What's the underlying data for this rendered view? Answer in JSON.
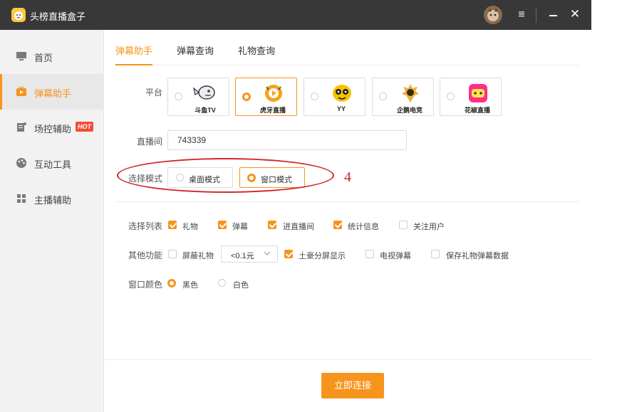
{
  "window": {
    "title": "头榜直播盒子"
  },
  "sidebar": {
    "items": [
      {
        "label": "首页",
        "icon": "monitor-icon"
      },
      {
        "label": "弹幕助手",
        "icon": "play-tv-icon"
      },
      {
        "label": "场控辅助",
        "icon": "document-icon",
        "badge": "HOT"
      },
      {
        "label": "互动工具",
        "icon": "palette-icon"
      },
      {
        "label": "主播辅助",
        "icon": "grid-icon"
      }
    ],
    "active_index": 1
  },
  "tabs": [
    {
      "label": "弹幕助手"
    },
    {
      "label": "弹幕查询"
    },
    {
      "label": "礼物查询"
    }
  ],
  "form": {
    "platform_label": "平台",
    "platforms": [
      {
        "label": "斗鱼TV"
      },
      {
        "label": "虎牙直播"
      },
      {
        "label": "YY"
      },
      {
        "label": "企鹅电竞"
      },
      {
        "label": "花椒直播"
      }
    ],
    "room_label": "直播间",
    "room_value": "743339",
    "mode_label": "选择模式",
    "modes": [
      {
        "label": "桌面模式"
      },
      {
        "label": "窗口模式"
      }
    ],
    "list_label": "选择列表",
    "list_options": [
      {
        "label": "礼物",
        "checked": true
      },
      {
        "label": "弹幕",
        "checked": true
      },
      {
        "label": "进直播间",
        "checked": true
      },
      {
        "label": "统计信息",
        "checked": true
      },
      {
        "label": "关注用户",
        "checked": false
      }
    ],
    "other_label": "其他功能",
    "other_options": [
      {
        "label": "屏蔽礼物",
        "checked": false
      },
      {
        "label": "土豪分屏显示",
        "checked": true
      },
      {
        "label": "电视弹幕",
        "checked": false
      },
      {
        "label": "保存礼物弹幕数据",
        "checked": false
      }
    ],
    "gift_filter_value": "<0.1元",
    "color_label": "窗口颜色",
    "colors": [
      {
        "label": "黑色",
        "checked": true
      },
      {
        "label": "白色",
        "checked": false
      }
    ]
  },
  "annotation": {
    "number": "4",
    "color": "#d2232a"
  },
  "actions": {
    "connect_label": "立即连接"
  },
  "theme": {
    "accent": "#f7941d",
    "titlebar": "#383838",
    "hot_badge": "#f24c38"
  }
}
